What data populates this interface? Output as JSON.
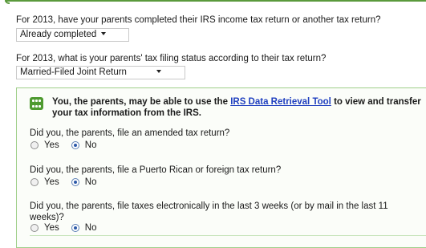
{
  "q_parents_tax_completed": {
    "label": "For 2013, have your parents completed their IRS income tax return or another tax return?",
    "selected": "Already completed"
  },
  "q_filing_status": {
    "label": "For 2013, what is your parents' tax filing status according to their tax return?",
    "selected": "Married-Filed Joint Return"
  },
  "info": {
    "text_before": "You, the parents, may be able to use the ",
    "link": "IRS Data Retrieval Tool",
    "text_after": " to view and transfer your tax information from the IRS."
  },
  "questions": [
    {
      "label": "Did you, the parents, file an amended tax return?",
      "yes": "Yes",
      "no": "No",
      "selected": "No"
    },
    {
      "label": "Did you, the parents, file a Puerto Rican or foreign tax return?",
      "yes": "Yes",
      "no": "No",
      "selected": "No"
    },
    {
      "label": "Did you, the parents, file taxes electronically in the last 3 weeks (or by mail in the last 11 weeks)?",
      "yes": "Yes",
      "no": "No",
      "selected": "No"
    }
  ],
  "colors": {
    "accent_green": "#4e9a2f",
    "link": "#1f3fbf",
    "panel_border": "#9fcf8a"
  }
}
